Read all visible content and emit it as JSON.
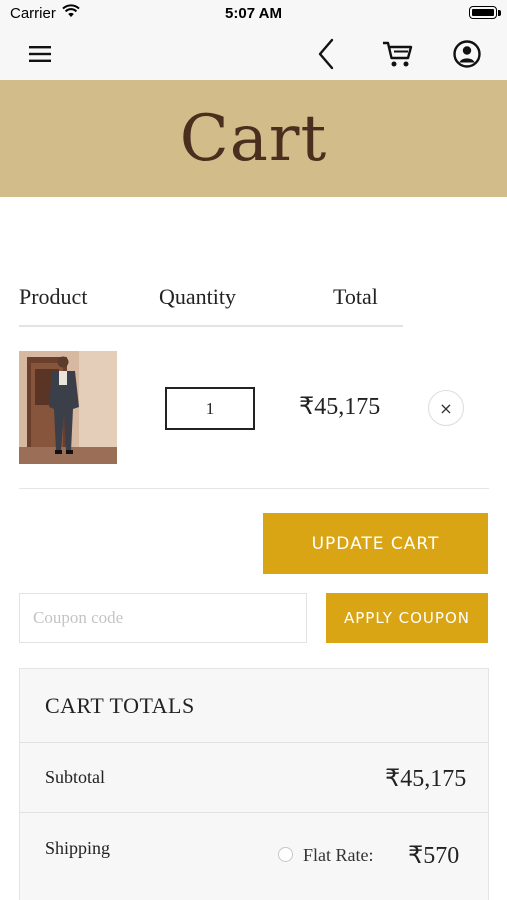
{
  "status_bar": {
    "carrier": "Carrier",
    "time": "5:07 AM"
  },
  "nav": {
    "icons": [
      "menu-icon",
      "back-icon",
      "cart-icon",
      "account-icon"
    ]
  },
  "hero": {
    "title": "Cart",
    "background": "#d2bd8a",
    "title_color": "#4a2e1e"
  },
  "table": {
    "headers": {
      "product": "Product",
      "quantity": "Quantity",
      "total": "Total"
    },
    "item": {
      "quantity": "1",
      "total": "₹45,175",
      "remove": "×"
    }
  },
  "actions": {
    "update_cart": "UPDATE CART",
    "coupon_placeholder": "Coupon code",
    "apply_coupon": "APPLY COUPON",
    "accent": "#daa514"
  },
  "totals": {
    "title": "CART TOTALS",
    "subtotal_label": "Subtotal",
    "subtotal_value": "₹45,175",
    "shipping_label": "Shipping",
    "shipping_option": "Flat Rate:",
    "shipping_value": "₹570"
  }
}
